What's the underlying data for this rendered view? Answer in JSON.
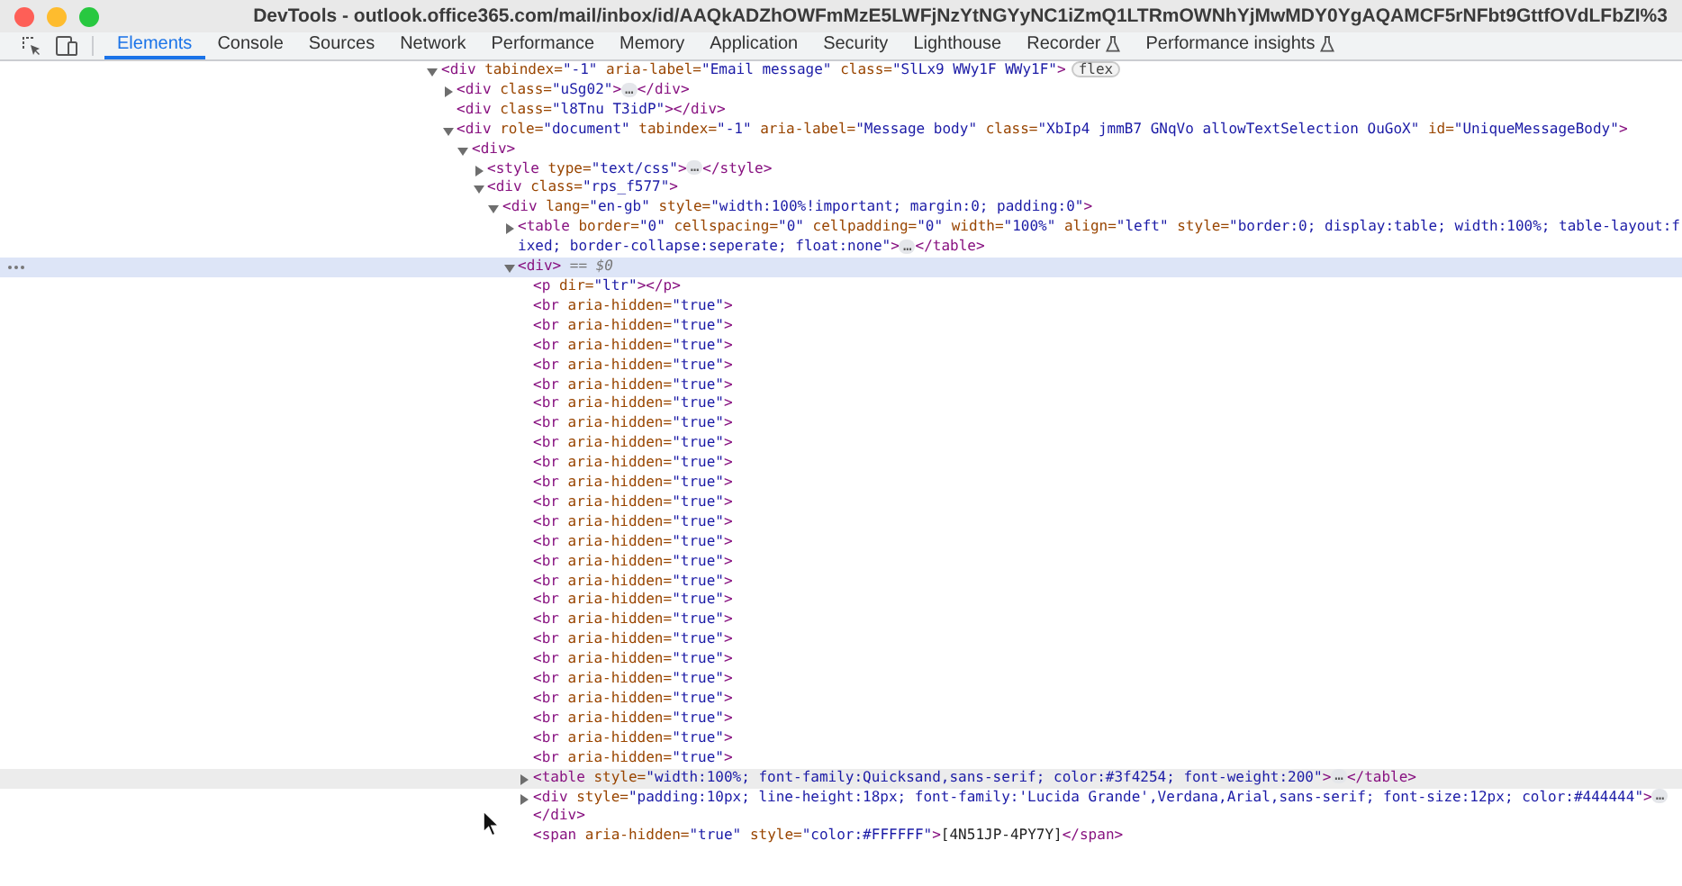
{
  "window": {
    "title": "DevTools - outlook.office365.com/mail/inbox/id/AAQkADZhOWFmMzE5LWFjNzYtNGYyNC1iZmQ1LTRmOWNhYjMwMDY0YgAQAMCF5rNFbt9GttfOVdLFbZI%3"
  },
  "tabs": [
    {
      "label": "Elements",
      "selected": true,
      "experimental": false
    },
    {
      "label": "Console",
      "selected": false,
      "experimental": false
    },
    {
      "label": "Sources",
      "selected": false,
      "experimental": false
    },
    {
      "label": "Network",
      "selected": false,
      "experimental": false
    },
    {
      "label": "Performance",
      "selected": false,
      "experimental": false
    },
    {
      "label": "Memory",
      "selected": false,
      "experimental": false
    },
    {
      "label": "Application",
      "selected": false,
      "experimental": false
    },
    {
      "label": "Security",
      "selected": false,
      "experimental": false
    },
    {
      "label": "Lighthouse",
      "selected": false,
      "experimental": false
    },
    {
      "label": "Recorder",
      "selected": false,
      "experimental": true
    },
    {
      "label": "Performance insights",
      "selected": false,
      "experimental": true
    }
  ],
  "tree": [
    {
      "code": [
        {
          "kind": "tag",
          "text": "<div"
        },
        {
          "kind": "attr",
          "text": " tabindex="
        },
        {
          "kind": "value",
          "text": "\"-1\""
        },
        {
          "kind": "attr",
          "text": " aria-label="
        },
        {
          "kind": "value",
          "text": "\"Email message\""
        },
        {
          "kind": "attr",
          "text": " class="
        },
        {
          "kind": "value",
          "text": "\"SlLx9 WWy1F WWy1F\""
        },
        {
          "kind": "tag",
          "text": ">"
        },
        {
          "kind": "badge",
          "text": "flex"
        }
      ],
      "expanded": true,
      "selected": false,
      "hovered": false,
      "children": [
        {
          "code": [
            {
              "kind": "tag",
              "text": "<div"
            },
            {
              "kind": "attr",
              "text": " class="
            },
            {
              "kind": "value",
              "text": "\"uSg02\""
            },
            {
              "kind": "tag",
              "text": ">"
            },
            {
              "kind": "ellipsis",
              "text": "…"
            },
            {
              "kind": "tag",
              "text": "</div>"
            }
          ],
          "expanded": false,
          "selected": false,
          "hovered": false
        },
        {
          "code": [
            {
              "kind": "tag",
              "text": "<div"
            },
            {
              "kind": "attr",
              "text": " class="
            },
            {
              "kind": "value",
              "text": "\"l8Tnu T3idP\""
            },
            {
              "kind": "tag",
              "text": "></div>"
            }
          ],
          "selected": false,
          "hovered": false
        },
        {
          "code": [
            {
              "kind": "tag",
              "text": "<div"
            },
            {
              "kind": "attr",
              "text": " role="
            },
            {
              "kind": "value",
              "text": "\"document\""
            },
            {
              "kind": "attr",
              "text": " tabindex="
            },
            {
              "kind": "value",
              "text": "\"-1\""
            },
            {
              "kind": "attr",
              "text": " aria-label="
            },
            {
              "kind": "value",
              "text": "\"Message body\""
            },
            {
              "kind": "attr",
              "text": " class="
            },
            {
              "kind": "value",
              "text": "\"XbIp4 jmmB7 GNqVo allowTextSelection OuGoX\""
            },
            {
              "kind": "attr",
              "text": " id="
            },
            {
              "kind": "value",
              "text": "\"UniqueMessageBody\""
            },
            {
              "kind": "tag",
              "text": ">"
            }
          ],
          "expanded": true,
          "selected": false,
          "hovered": false,
          "children": [
            {
              "code": [
                {
                  "kind": "tag",
                  "text": "<div>"
                }
              ],
              "expanded": true,
              "selected": false,
              "hovered": false,
              "children": [
                {
                  "code": [
                    {
                      "kind": "tag",
                      "text": "<style"
                    },
                    {
                      "kind": "attr",
                      "text": " type="
                    },
                    {
                      "kind": "value",
                      "text": "\"text/css\""
                    },
                    {
                      "kind": "tag",
                      "text": ">"
                    },
                    {
                      "kind": "ellipsis",
                      "text": "…"
                    },
                    {
                      "kind": "tag",
                      "text": "</style>"
                    }
                  ],
                  "expanded": false,
                  "selected": false,
                  "hovered": false
                },
                {
                  "code": [
                    {
                      "kind": "tag",
                      "text": "<div"
                    },
                    {
                      "kind": "attr",
                      "text": " class="
                    },
                    {
                      "kind": "value",
                      "text": "\"rps_f577\""
                    },
                    {
                      "kind": "tag",
                      "text": ">"
                    }
                  ],
                  "expanded": true,
                  "selected": false,
                  "hovered": false,
                  "children": [
                    {
                      "code": [
                        {
                          "kind": "tag",
                          "text": "<div"
                        },
                        {
                          "kind": "attr",
                          "text": " lang="
                        },
                        {
                          "kind": "value",
                          "text": "\"en-gb\""
                        },
                        {
                          "kind": "attr",
                          "text": " style="
                        },
                        {
                          "kind": "value",
                          "text": "\"width:100%!important; margin:0; padding:0\""
                        },
                        {
                          "kind": "tag",
                          "text": ">"
                        }
                      ],
                      "expanded": true,
                      "selected": false,
                      "hovered": false,
                      "children": [
                        {
                          "code": [
                            {
                              "kind": "tag",
                              "text": "<table"
                            },
                            {
                              "kind": "attr",
                              "text": " border="
                            },
                            {
                              "kind": "value",
                              "text": "\"0\""
                            },
                            {
                              "kind": "attr",
                              "text": " cellspacing="
                            },
                            {
                              "kind": "value",
                              "text": "\"0\""
                            },
                            {
                              "kind": "attr",
                              "text": " cellpadding="
                            },
                            {
                              "kind": "value",
                              "text": "\"0\""
                            },
                            {
                              "kind": "attr",
                              "text": " width="
                            },
                            {
                              "kind": "value",
                              "text": "\"100%\""
                            },
                            {
                              "kind": "attr",
                              "text": " align="
                            },
                            {
                              "kind": "value",
                              "text": "\"left\""
                            },
                            {
                              "kind": "attr",
                              "text": " style="
                            },
                            {
                              "kind": "value",
                              "text": "\"border:0; display:table; width:100%; table-layout:fixed; border-collapse:seperate; float:none\""
                            },
                            {
                              "kind": "tag",
                              "text": ">"
                            },
                            {
                              "kind": "ellipsis",
                              "text": "…"
                            },
                            {
                              "kind": "tag",
                              "text": "</table>"
                            }
                          ],
                          "expanded": false,
                          "selected": false,
                          "hovered": false
                        },
                        {
                          "code": [
                            {
                              "kind": "tag",
                              "text": "<div>"
                            },
                            {
                              "kind": "dollar",
                              "text": " == $0"
                            }
                          ],
                          "expanded": true,
                          "selected": true,
                          "hovered": false,
                          "children": [
                            {
                              "code": [
                                {
                                  "kind": "tag",
                                  "text": "<p"
                                },
                                {
                                  "kind": "attr",
                                  "text": " dir="
                                },
                                {
                                  "kind": "value",
                                  "text": "\"ltr\""
                                },
                                {
                                  "kind": "tag",
                                  "text": "></p>"
                                }
                              ],
                              "selected": false,
                              "hovered": false
                            },
                            {
                              "code": [
                                {
                                  "kind": "tag",
                                  "text": "<br"
                                },
                                {
                                  "kind": "attr",
                                  "text": " aria-hidden="
                                },
                                {
                                  "kind": "value",
                                  "text": "\"true\""
                                },
                                {
                                  "kind": "tag",
                                  "text": ">"
                                }
                              ],
                              "selected": false,
                              "hovered": false
                            },
                            {
                              "code": [
                                {
                                  "kind": "tag",
                                  "text": "<br"
                                },
                                {
                                  "kind": "attr",
                                  "text": " aria-hidden="
                                },
                                {
                                  "kind": "value",
                                  "text": "\"true\""
                                },
                                {
                                  "kind": "tag",
                                  "text": ">"
                                }
                              ],
                              "selected": false,
                              "hovered": false
                            },
                            {
                              "code": [
                                {
                                  "kind": "tag",
                                  "text": "<br"
                                },
                                {
                                  "kind": "attr",
                                  "text": " aria-hidden="
                                },
                                {
                                  "kind": "value",
                                  "text": "\"true\""
                                },
                                {
                                  "kind": "tag",
                                  "text": ">"
                                }
                              ],
                              "selected": false,
                              "hovered": false
                            },
                            {
                              "code": [
                                {
                                  "kind": "tag",
                                  "text": "<br"
                                },
                                {
                                  "kind": "attr",
                                  "text": " aria-hidden="
                                },
                                {
                                  "kind": "value",
                                  "text": "\"true\""
                                },
                                {
                                  "kind": "tag",
                                  "text": ">"
                                }
                              ],
                              "selected": false,
                              "hovered": false
                            },
                            {
                              "code": [
                                {
                                  "kind": "tag",
                                  "text": "<br"
                                },
                                {
                                  "kind": "attr",
                                  "text": " aria-hidden="
                                },
                                {
                                  "kind": "value",
                                  "text": "\"true\""
                                },
                                {
                                  "kind": "tag",
                                  "text": ">"
                                }
                              ],
                              "selected": false,
                              "hovered": false
                            },
                            {
                              "code": [
                                {
                                  "kind": "tag",
                                  "text": "<br"
                                },
                                {
                                  "kind": "attr",
                                  "text": " aria-hidden="
                                },
                                {
                                  "kind": "value",
                                  "text": "\"true\""
                                },
                                {
                                  "kind": "tag",
                                  "text": ">"
                                }
                              ],
                              "selected": false,
                              "hovered": false
                            },
                            {
                              "code": [
                                {
                                  "kind": "tag",
                                  "text": "<br"
                                },
                                {
                                  "kind": "attr",
                                  "text": " aria-hidden="
                                },
                                {
                                  "kind": "value",
                                  "text": "\"true\""
                                },
                                {
                                  "kind": "tag",
                                  "text": ">"
                                }
                              ],
                              "selected": false,
                              "hovered": false
                            },
                            {
                              "code": [
                                {
                                  "kind": "tag",
                                  "text": "<br"
                                },
                                {
                                  "kind": "attr",
                                  "text": " aria-hidden="
                                },
                                {
                                  "kind": "value",
                                  "text": "\"true\""
                                },
                                {
                                  "kind": "tag",
                                  "text": ">"
                                }
                              ],
                              "selected": false,
                              "hovered": false
                            },
                            {
                              "code": [
                                {
                                  "kind": "tag",
                                  "text": "<br"
                                },
                                {
                                  "kind": "attr",
                                  "text": " aria-hidden="
                                },
                                {
                                  "kind": "value",
                                  "text": "\"true\""
                                },
                                {
                                  "kind": "tag",
                                  "text": ">"
                                }
                              ],
                              "selected": false,
                              "hovered": false
                            },
                            {
                              "code": [
                                {
                                  "kind": "tag",
                                  "text": "<br"
                                },
                                {
                                  "kind": "attr",
                                  "text": " aria-hidden="
                                },
                                {
                                  "kind": "value",
                                  "text": "\"true\""
                                },
                                {
                                  "kind": "tag",
                                  "text": ">"
                                }
                              ],
                              "selected": false,
                              "hovered": false
                            },
                            {
                              "code": [
                                {
                                  "kind": "tag",
                                  "text": "<br"
                                },
                                {
                                  "kind": "attr",
                                  "text": " aria-hidden="
                                },
                                {
                                  "kind": "value",
                                  "text": "\"true\""
                                },
                                {
                                  "kind": "tag",
                                  "text": ">"
                                }
                              ],
                              "selected": false,
                              "hovered": false
                            },
                            {
                              "code": [
                                {
                                  "kind": "tag",
                                  "text": "<br"
                                },
                                {
                                  "kind": "attr",
                                  "text": " aria-hidden="
                                },
                                {
                                  "kind": "value",
                                  "text": "\"true\""
                                },
                                {
                                  "kind": "tag",
                                  "text": ">"
                                }
                              ],
                              "selected": false,
                              "hovered": false
                            },
                            {
                              "code": [
                                {
                                  "kind": "tag",
                                  "text": "<br"
                                },
                                {
                                  "kind": "attr",
                                  "text": " aria-hidden="
                                },
                                {
                                  "kind": "value",
                                  "text": "\"true\""
                                },
                                {
                                  "kind": "tag",
                                  "text": ">"
                                }
                              ],
                              "selected": false,
                              "hovered": false
                            },
                            {
                              "code": [
                                {
                                  "kind": "tag",
                                  "text": "<br"
                                },
                                {
                                  "kind": "attr",
                                  "text": " aria-hidden="
                                },
                                {
                                  "kind": "value",
                                  "text": "\"true\""
                                },
                                {
                                  "kind": "tag",
                                  "text": ">"
                                }
                              ],
                              "selected": false,
                              "hovered": false
                            },
                            {
                              "code": [
                                {
                                  "kind": "tag",
                                  "text": "<br"
                                },
                                {
                                  "kind": "attr",
                                  "text": " aria-hidden="
                                },
                                {
                                  "kind": "value",
                                  "text": "\"true\""
                                },
                                {
                                  "kind": "tag",
                                  "text": ">"
                                }
                              ],
                              "selected": false,
                              "hovered": false
                            },
                            {
                              "code": [
                                {
                                  "kind": "tag",
                                  "text": "<br"
                                },
                                {
                                  "kind": "attr",
                                  "text": " aria-hidden="
                                },
                                {
                                  "kind": "value",
                                  "text": "\"true\""
                                },
                                {
                                  "kind": "tag",
                                  "text": ">"
                                }
                              ],
                              "selected": false,
                              "hovered": false
                            },
                            {
                              "code": [
                                {
                                  "kind": "tag",
                                  "text": "<br"
                                },
                                {
                                  "kind": "attr",
                                  "text": " aria-hidden="
                                },
                                {
                                  "kind": "value",
                                  "text": "\"true\""
                                },
                                {
                                  "kind": "tag",
                                  "text": ">"
                                }
                              ],
                              "selected": false,
                              "hovered": false
                            },
                            {
                              "code": [
                                {
                                  "kind": "tag",
                                  "text": "<br"
                                },
                                {
                                  "kind": "attr",
                                  "text": " aria-hidden="
                                },
                                {
                                  "kind": "value",
                                  "text": "\"true\""
                                },
                                {
                                  "kind": "tag",
                                  "text": ">"
                                }
                              ],
                              "selected": false,
                              "hovered": false
                            },
                            {
                              "code": [
                                {
                                  "kind": "tag",
                                  "text": "<br"
                                },
                                {
                                  "kind": "attr",
                                  "text": " aria-hidden="
                                },
                                {
                                  "kind": "value",
                                  "text": "\"true\""
                                },
                                {
                                  "kind": "tag",
                                  "text": ">"
                                }
                              ],
                              "selected": false,
                              "hovered": false
                            },
                            {
                              "code": [
                                {
                                  "kind": "tag",
                                  "text": "<br"
                                },
                                {
                                  "kind": "attr",
                                  "text": " aria-hidden="
                                },
                                {
                                  "kind": "value",
                                  "text": "\"true\""
                                },
                                {
                                  "kind": "tag",
                                  "text": ">"
                                }
                              ],
                              "selected": false,
                              "hovered": false
                            },
                            {
                              "code": [
                                {
                                  "kind": "tag",
                                  "text": "<br"
                                },
                                {
                                  "kind": "attr",
                                  "text": " aria-hidden="
                                },
                                {
                                  "kind": "value",
                                  "text": "\"true\""
                                },
                                {
                                  "kind": "tag",
                                  "text": ">"
                                }
                              ],
                              "selected": false,
                              "hovered": false
                            },
                            {
                              "code": [
                                {
                                  "kind": "tag",
                                  "text": "<br"
                                },
                                {
                                  "kind": "attr",
                                  "text": " aria-hidden="
                                },
                                {
                                  "kind": "value",
                                  "text": "\"true\""
                                },
                                {
                                  "kind": "tag",
                                  "text": ">"
                                }
                              ],
                              "selected": false,
                              "hovered": false
                            },
                            {
                              "code": [
                                {
                                  "kind": "tag",
                                  "text": "<br"
                                },
                                {
                                  "kind": "attr",
                                  "text": " aria-hidden="
                                },
                                {
                                  "kind": "value",
                                  "text": "\"true\""
                                },
                                {
                                  "kind": "tag",
                                  "text": ">"
                                }
                              ],
                              "selected": false,
                              "hovered": false
                            },
                            {
                              "code": [
                                {
                                  "kind": "tag",
                                  "text": "<br"
                                },
                                {
                                  "kind": "attr",
                                  "text": " aria-hidden="
                                },
                                {
                                  "kind": "value",
                                  "text": "\"true\""
                                },
                                {
                                  "kind": "tag",
                                  "text": ">"
                                }
                              ],
                              "selected": false,
                              "hovered": false
                            },
                            {
                              "code": [
                                {
                                  "kind": "tag",
                                  "text": "<table"
                                },
                                {
                                  "kind": "attr",
                                  "text": " style="
                                },
                                {
                                  "kind": "value",
                                  "text": "\"width:100%; font-family:Quicksand,sans-serif; color:#3f4254; font-weight:200\""
                                },
                                {
                                  "kind": "tag",
                                  "text": ">"
                                },
                                {
                                  "kind": "ellipsis",
                                  "text": "…"
                                },
                                {
                                  "kind": "tag",
                                  "text": "</table>"
                                }
                              ],
                              "expanded": false,
                              "selected": false,
                              "hovered": true
                            },
                            {
                              "code": [
                                {
                                  "kind": "tag",
                                  "text": "<div"
                                },
                                {
                                  "kind": "attr",
                                  "text": " style="
                                },
                                {
                                  "kind": "value",
                                  "text": "\"padding:10px; line-height:18px; font-family:'Lucida Grande',Verdana,Arial,sans-serif; font-size:12px; color:#444444\""
                                },
                                {
                                  "kind": "tag",
                                  "text": ">"
                                },
                                {
                                  "kind": "ellipsis",
                                  "text": "…"
                                }
                              ],
                              "expanded": false,
                              "selected": false,
                              "hovered": false
                            },
                            {
                              "code": [
                                {
                                  "kind": "tag",
                                  "text": "</div>"
                                }
                              ],
                              "selected": false,
                              "hovered": false
                            },
                            {
                              "code": [
                                {
                                  "kind": "tag",
                                  "text": "<span"
                                },
                                {
                                  "kind": "attr",
                                  "text": " aria-hidden="
                                },
                                {
                                  "kind": "value",
                                  "text": "\"true\""
                                },
                                {
                                  "kind": "attr",
                                  "text": " style="
                                },
                                {
                                  "kind": "value",
                                  "text": "\"color:#FFFFFF\""
                                },
                                {
                                  "kind": "tag",
                                  "text": ">"
                                },
                                {
                                  "kind": "text",
                                  "text": "[4N51JP-4PY7Y]"
                                },
                                {
                                  "kind": "tag",
                                  "text": "</span>"
                                }
                              ],
                              "selected": false,
                              "hovered": false
                            }
                          ]
                        }
                      ]
                    }
                  ]
                }
              ]
            }
          ]
        }
      ]
    }
  ]
}
